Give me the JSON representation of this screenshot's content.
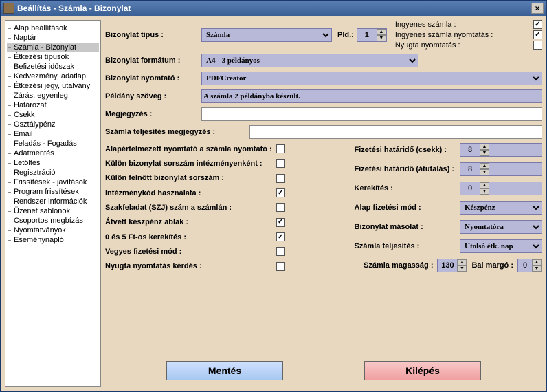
{
  "window": {
    "title": "Beállítás - Számla - Bizonylat"
  },
  "sidebar": {
    "items": [
      "Alap beállítások",
      "Naptár",
      "Számla - Bizonylat",
      "Étkezési típusok",
      "Befizetési időszak",
      "Kedvezmény, adatlap",
      "Étkezési jegy, utalvány",
      "Zárás, egyenleg",
      "Határozat",
      "Csekk",
      "Osztálypénz",
      "Email",
      "Feladás - Fogadás",
      "Adatmentés",
      "Letöltés",
      "Regisztráció",
      "Frissítések - javítások",
      "Program frissítések",
      "Rendszer információk",
      "Üzenet sablonok",
      "Csoportos megbízás",
      "Nyomtatványok",
      "Eseménynapló"
    ],
    "selected": 2
  },
  "form": {
    "labels": {
      "tipus": "Bizonylat típus :",
      "formatum": "Bizonylat formátum :",
      "nyomtato": "Bizonylat nyomtató :",
      "peldany": "Példány szöveg :",
      "megjegyzes": "Megjegyzés :",
      "szamla_telj_megj": "Számla teljesítés megjegyzés :",
      "pld": "Pld.:",
      "ingyenes": "Ingyenes számla :",
      "ingyenes_ny": "Ingyenes számla nyomtatás :",
      "nyugta_ny": "Nyugta nyomtatás :",
      "fiz_csekk": "Fizetési határidő (csekk) :",
      "fiz_atut": "Fizetési határidő (átutalás) :",
      "kerekites": "Kerekítés :",
      "alap_fizmod": "Alap fizetési mód :",
      "biz_masolat": "Bizonylat másolat :",
      "szamla_telj": "Számla teljesítés :",
      "szamla_mag": "Számla magasság :",
      "bal_margo": "Bal margó :"
    },
    "tipus": "Számla",
    "pld": "1",
    "formatum": "A4 - 3 példányos",
    "nyomtato": "PDFCreator",
    "peldany_szoveg": "A számla 2 példányba készült.",
    "megjegyzes": "",
    "szamla_telj_megj": "",
    "check_labels": {
      "c0": "Alapértelmezett nyomtató a számla nyomtató :",
      "c1": "Külön bizonylat sorszám intézményenként :",
      "c2": "Külön felnőtt bizonylat sorszám :",
      "c3": "Intézménykód használata :",
      "c4": "Szakfeladat (SZJ) szám a számlán :",
      "c5": "Átvett készpénz ablak :",
      "c6": "0 és 5 Ft-os kerekítés :",
      "c7": "Vegyes fizetési mód :",
      "c8": "Nyugta nyomtatás kérdés :"
    },
    "checks": {
      "c0": false,
      "c1": false,
      "c2": false,
      "c3": true,
      "c4": false,
      "c5": true,
      "c6": true,
      "c7": false,
      "c8": false
    },
    "topchecks": {
      "ingyenes": true,
      "ingyenes_ny": true,
      "nyugta_ny": false
    },
    "fiz_csekk": "8",
    "fiz_atut": "8",
    "kerekites": "0",
    "alap_fizmod": "Készpénz",
    "biz_masolat": "Nyomtatóra",
    "szamla_telj": "Utolsó étk. nap",
    "szamla_mag": "130",
    "bal_margo": "0"
  },
  "buttons": {
    "save": "Mentés",
    "exit": "Kilépés"
  }
}
